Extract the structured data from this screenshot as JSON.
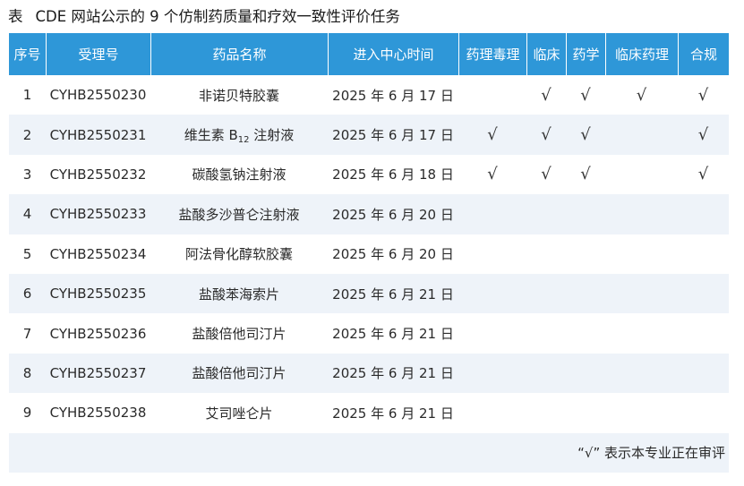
{
  "title": {
    "label": "表",
    "text": "CDE 网站公示的 9 个仿制药质量和疗效一致性评价任务"
  },
  "columns": [
    "序号",
    "受理号",
    "药品名称",
    "进入中心时间",
    "药理毒理",
    "临床",
    "药学",
    "临床药理",
    "合规"
  ],
  "check_mark": "√",
  "rows": [
    {
      "no": "1",
      "accept_no": "CYHB2550230",
      "drug": "非诺贝特胶囊",
      "drug_sub": "",
      "drug_suffix": "",
      "date": "2025 年 6 月 17 日",
      "pharm_tox": false,
      "clinical": true,
      "pharmacy": true,
      "clin_pharm": true,
      "compliance": true
    },
    {
      "no": "2",
      "accept_no": "CYHB2550231",
      "drug": "维生素 B",
      "drug_sub": "12",
      "drug_suffix": " 注射液",
      "date": "2025 年 6 月 17 日",
      "pharm_tox": true,
      "clinical": true,
      "pharmacy": true,
      "clin_pharm": false,
      "compliance": true
    },
    {
      "no": "3",
      "accept_no": "CYHB2550232",
      "drug": "碳酸氢钠注射液",
      "drug_sub": "",
      "drug_suffix": "",
      "date": "2025 年 6 月 18 日",
      "pharm_tox": true,
      "clinical": true,
      "pharmacy": true,
      "clin_pharm": false,
      "compliance": true
    },
    {
      "no": "4",
      "accept_no": "CYHB2550233",
      "drug": "盐酸多沙普仑注射液",
      "drug_sub": "",
      "drug_suffix": "",
      "date": "2025 年 6 月 20 日",
      "pharm_tox": false,
      "clinical": false,
      "pharmacy": false,
      "clin_pharm": false,
      "compliance": false
    },
    {
      "no": "5",
      "accept_no": "CYHB2550234",
      "drug": "阿法骨化醇软胶囊",
      "drug_sub": "",
      "drug_suffix": "",
      "date": "2025 年 6 月 20 日",
      "pharm_tox": false,
      "clinical": false,
      "pharmacy": false,
      "clin_pharm": false,
      "compliance": false
    },
    {
      "no": "6",
      "accept_no": "CYHB2550235",
      "drug": "盐酸苯海索片",
      "drug_sub": "",
      "drug_suffix": "",
      "date": "2025 年 6 月 21 日",
      "pharm_tox": false,
      "clinical": false,
      "pharmacy": false,
      "clin_pharm": false,
      "compliance": false
    },
    {
      "no": "7",
      "accept_no": "CYHB2550236",
      "drug": "盐酸倍他司汀片",
      "drug_sub": "",
      "drug_suffix": "",
      "date": "2025 年 6 月 21 日",
      "pharm_tox": false,
      "clinical": false,
      "pharmacy": false,
      "clin_pharm": false,
      "compliance": false
    },
    {
      "no": "8",
      "accept_no": "CYHB2550237",
      "drug": "盐酸倍他司汀片",
      "drug_sub": "",
      "drug_suffix": "",
      "date": "2025 年 6 月 21 日",
      "pharm_tox": false,
      "clinical": false,
      "pharmacy": false,
      "clin_pharm": false,
      "compliance": false
    },
    {
      "no": "9",
      "accept_no": "CYHB2550238",
      "drug": "艾司唑仑片",
      "drug_sub": "",
      "drug_suffix": "",
      "date": "2025 年 6 月 21 日",
      "pharm_tox": false,
      "clinical": false,
      "pharmacy": false,
      "clin_pharm": false,
      "compliance": false
    }
  ],
  "footnote": "“√” 表示本专业正在审评",
  "colors": {
    "header_bg": "#2e97d8",
    "stripe_bg": "#eef3f9"
  }
}
